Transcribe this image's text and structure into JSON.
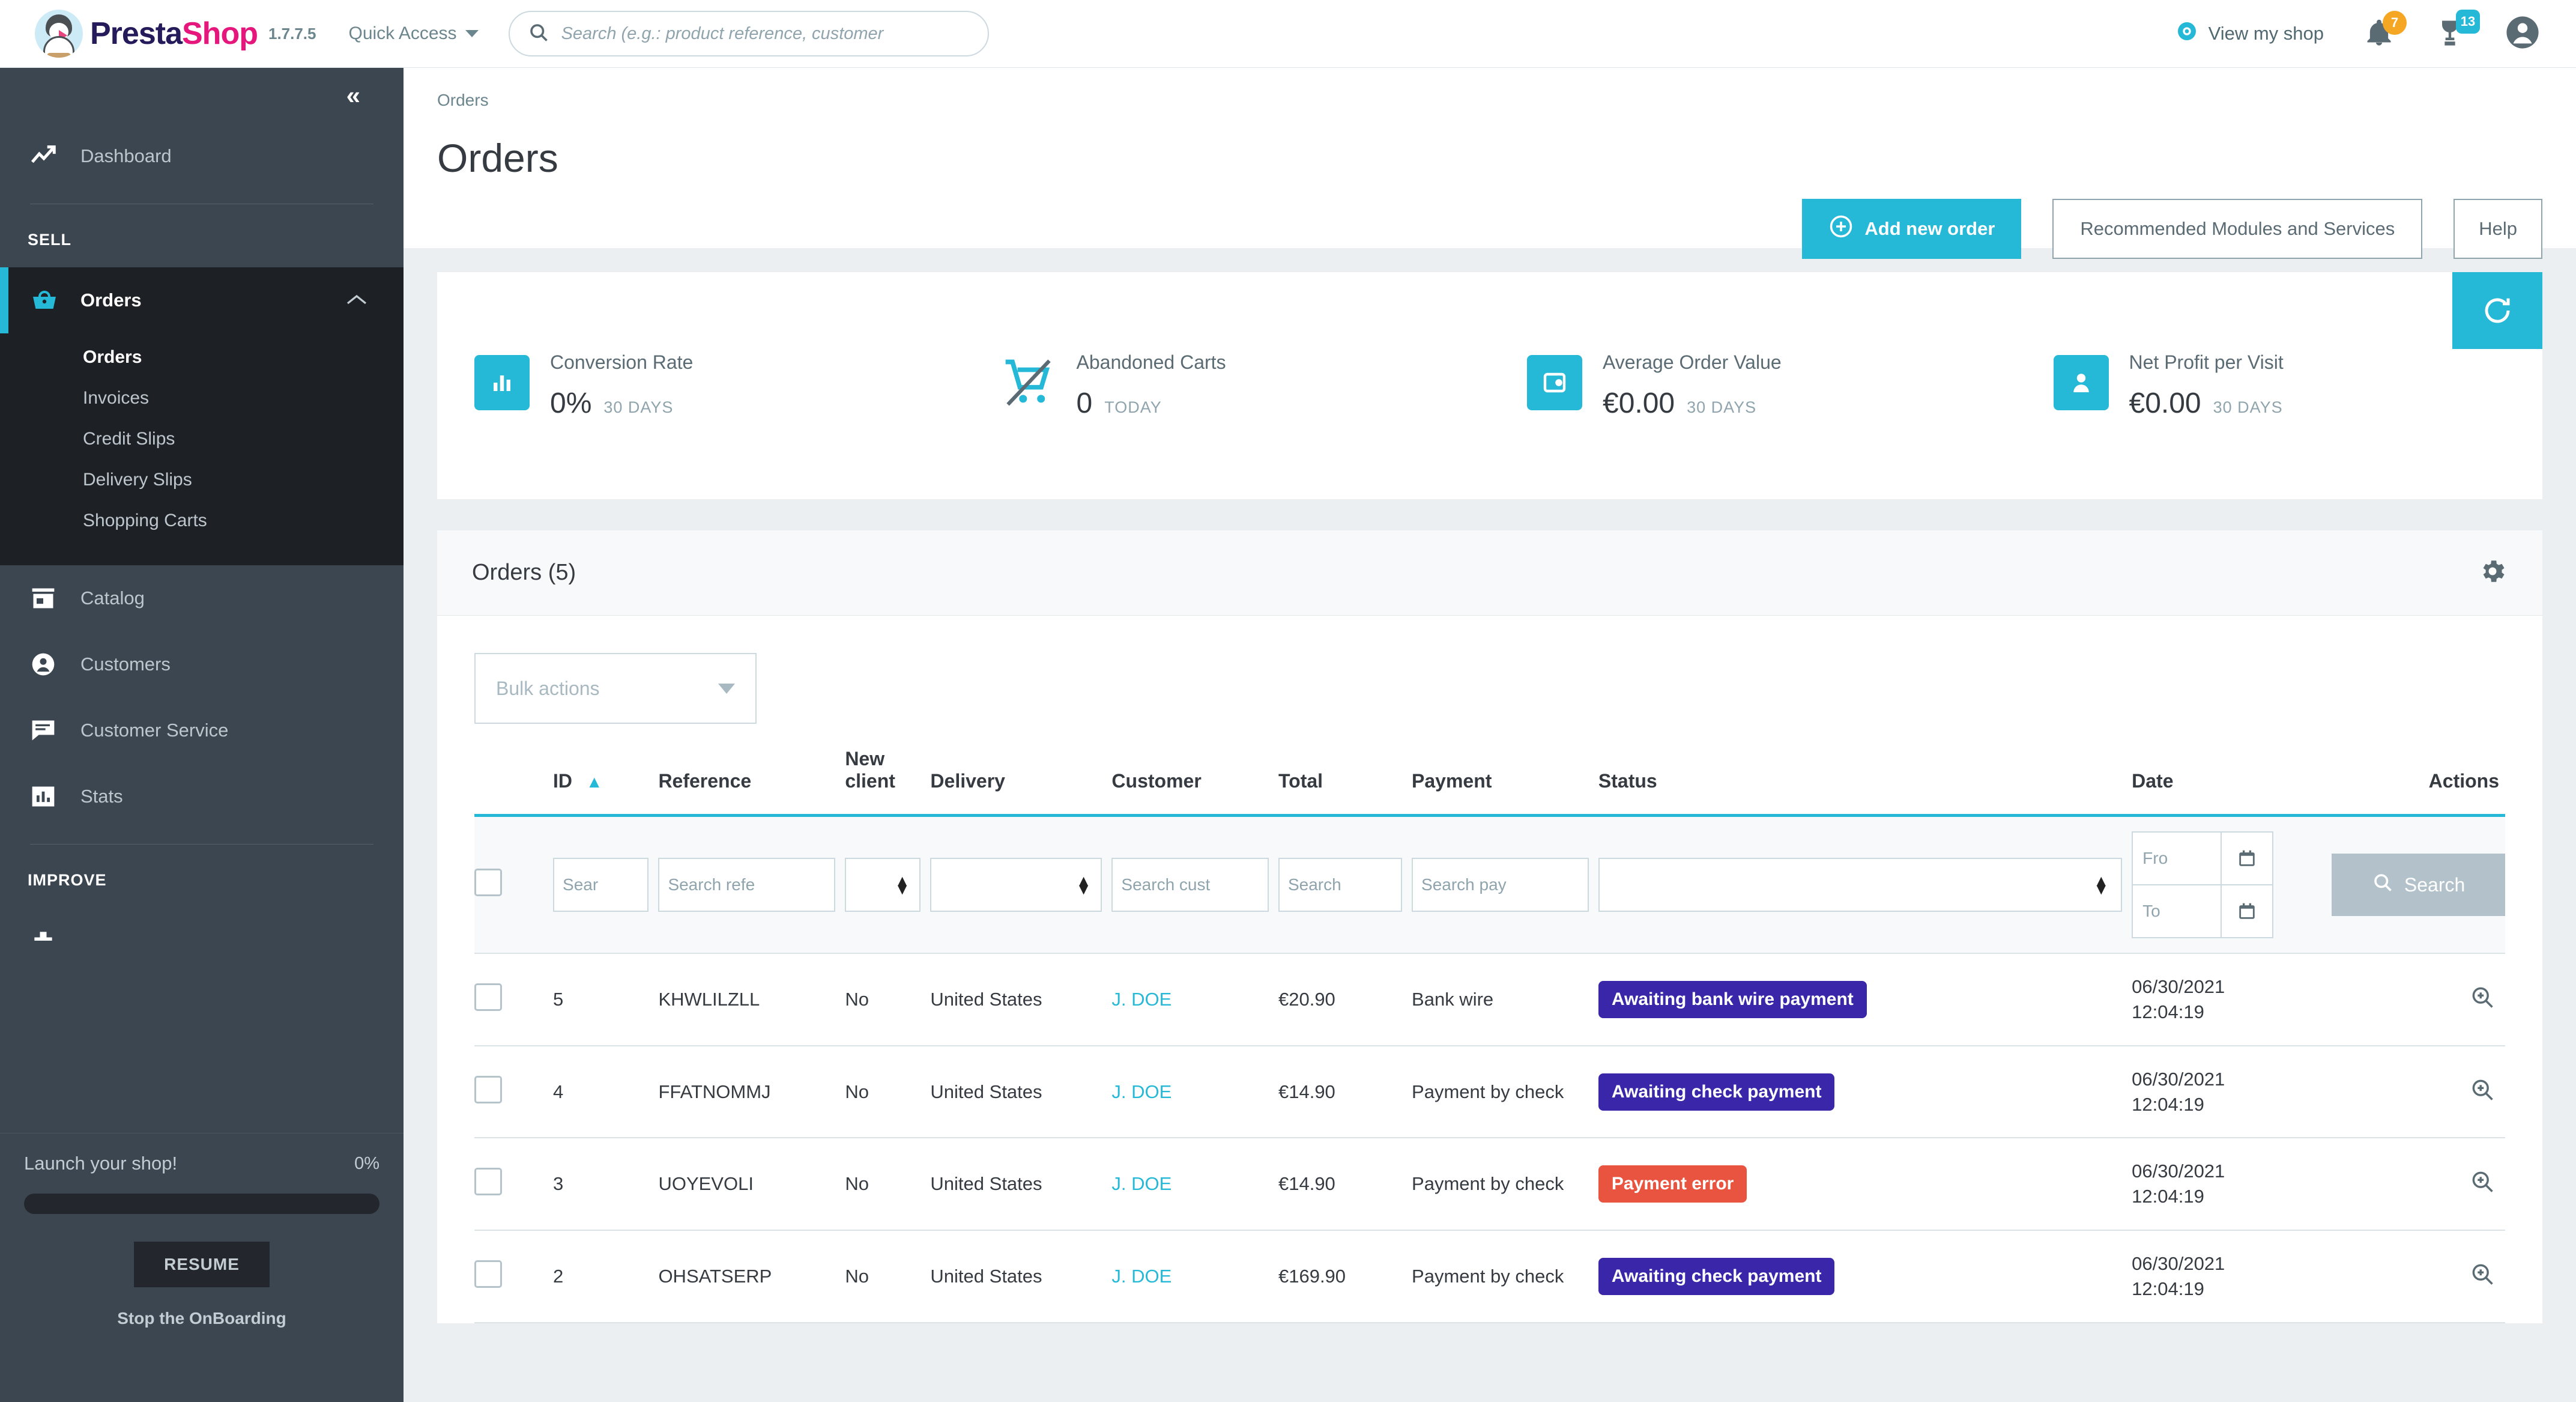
{
  "topbar": {
    "brand_prefix": "Presta",
    "brand_suffix": "Shop",
    "version": "1.7.7.5",
    "quick_access": "Quick Access",
    "search_placeholder": "Search (e.g.: product reference, customer ",
    "search_value": "",
    "view_shop": "View my shop",
    "notifications_badge": "7",
    "orders_badge": "13"
  },
  "sidebar": {
    "dashboard": "Dashboard",
    "section_sell": "SELL",
    "section_improve": "IMPROVE",
    "items": [
      {
        "label": "Orders"
      },
      {
        "label": "Catalog"
      },
      {
        "label": "Customers"
      },
      {
        "label": "Customer Service"
      },
      {
        "label": "Stats"
      }
    ],
    "submenu": [
      {
        "label": "Orders"
      },
      {
        "label": "Invoices"
      },
      {
        "label": "Credit Slips"
      },
      {
        "label": "Delivery Slips"
      },
      {
        "label": "Shopping Carts"
      }
    ],
    "onboarding": {
      "title": "Launch your shop!",
      "percent": "0%",
      "progress": 0,
      "resume": "RESUME",
      "stop": "Stop the OnBoarding"
    }
  },
  "page": {
    "breadcrumb": "Orders",
    "title": "Orders",
    "add_order": "Add new order",
    "recommended": "Recommended Modules and Services",
    "help": "Help"
  },
  "kpis": [
    {
      "label": "Conversion Rate",
      "value": "0%",
      "period": "30 DAYS",
      "icon": "bar-chart-icon"
    },
    {
      "label": "Abandoned Carts",
      "value": "0",
      "period": "TODAY",
      "icon": "abandoned-cart-icon"
    },
    {
      "label": "Average Order Value",
      "value": "€0.00",
      "period": "30 DAYS",
      "icon": "wallet-icon"
    },
    {
      "label": "Net Profit per Visit",
      "value": "€0.00",
      "period": "30 DAYS",
      "icon": "visitor-icon"
    }
  ],
  "orders_panel": {
    "title": "Orders (5)",
    "bulk_actions": "Bulk actions",
    "columns": [
      "ID",
      "Reference",
      "New client",
      "Delivery",
      "Customer",
      "Total",
      "Payment",
      "Status",
      "Date",
      "Actions"
    ],
    "sort_column": "ID",
    "sort_direction": "asc",
    "filters": {
      "id": "Sear",
      "reference": "Search refe",
      "customer": "Search cust",
      "total": "Search",
      "payment": "Search pay",
      "date_from": "Fro",
      "date_to": "To",
      "search_button": "Search"
    },
    "rows": [
      {
        "id": "5",
        "reference": "KHWLILZLL",
        "new_client": "No",
        "delivery": "United States",
        "customer": "J. DOE",
        "total": "€20.90",
        "payment": "Bank wire",
        "status": "Awaiting bank wire payment",
        "status_color": "#3a26a8",
        "date": "06/30/2021",
        "time": "12:04:19"
      },
      {
        "id": "4",
        "reference": "FFATNOMMJ",
        "new_client": "No",
        "delivery": "United States",
        "customer": "J. DOE",
        "total": "€14.90",
        "payment": "Payment by check",
        "status": "Awaiting check payment",
        "status_color": "#3a26a8",
        "date": "06/30/2021",
        "time": "12:04:19"
      },
      {
        "id": "3",
        "reference": "UOYEVOLI",
        "new_client": "No",
        "delivery": "United States",
        "customer": "J. DOE",
        "total": "€14.90",
        "payment": "Payment by check",
        "status": "Payment error",
        "status_color": "#e8543f",
        "date": "06/30/2021",
        "time": "12:04:19"
      },
      {
        "id": "2",
        "reference": "OHSATSERP",
        "new_client": "No",
        "delivery": "United States",
        "customer": "J. DOE",
        "total": "€169.90",
        "payment": "Payment by check",
        "status": "Awaiting check payment",
        "status_color": "#3a26a8",
        "date": "06/30/2021",
        "time": "12:04:19"
      }
    ]
  },
  "colors": {
    "accent": "#25b9d7",
    "sidebar": "#3c4650",
    "sidebar_active": "#1d2025",
    "brand_pink": "#e6177c",
    "brand_navy": "#251b5b"
  }
}
